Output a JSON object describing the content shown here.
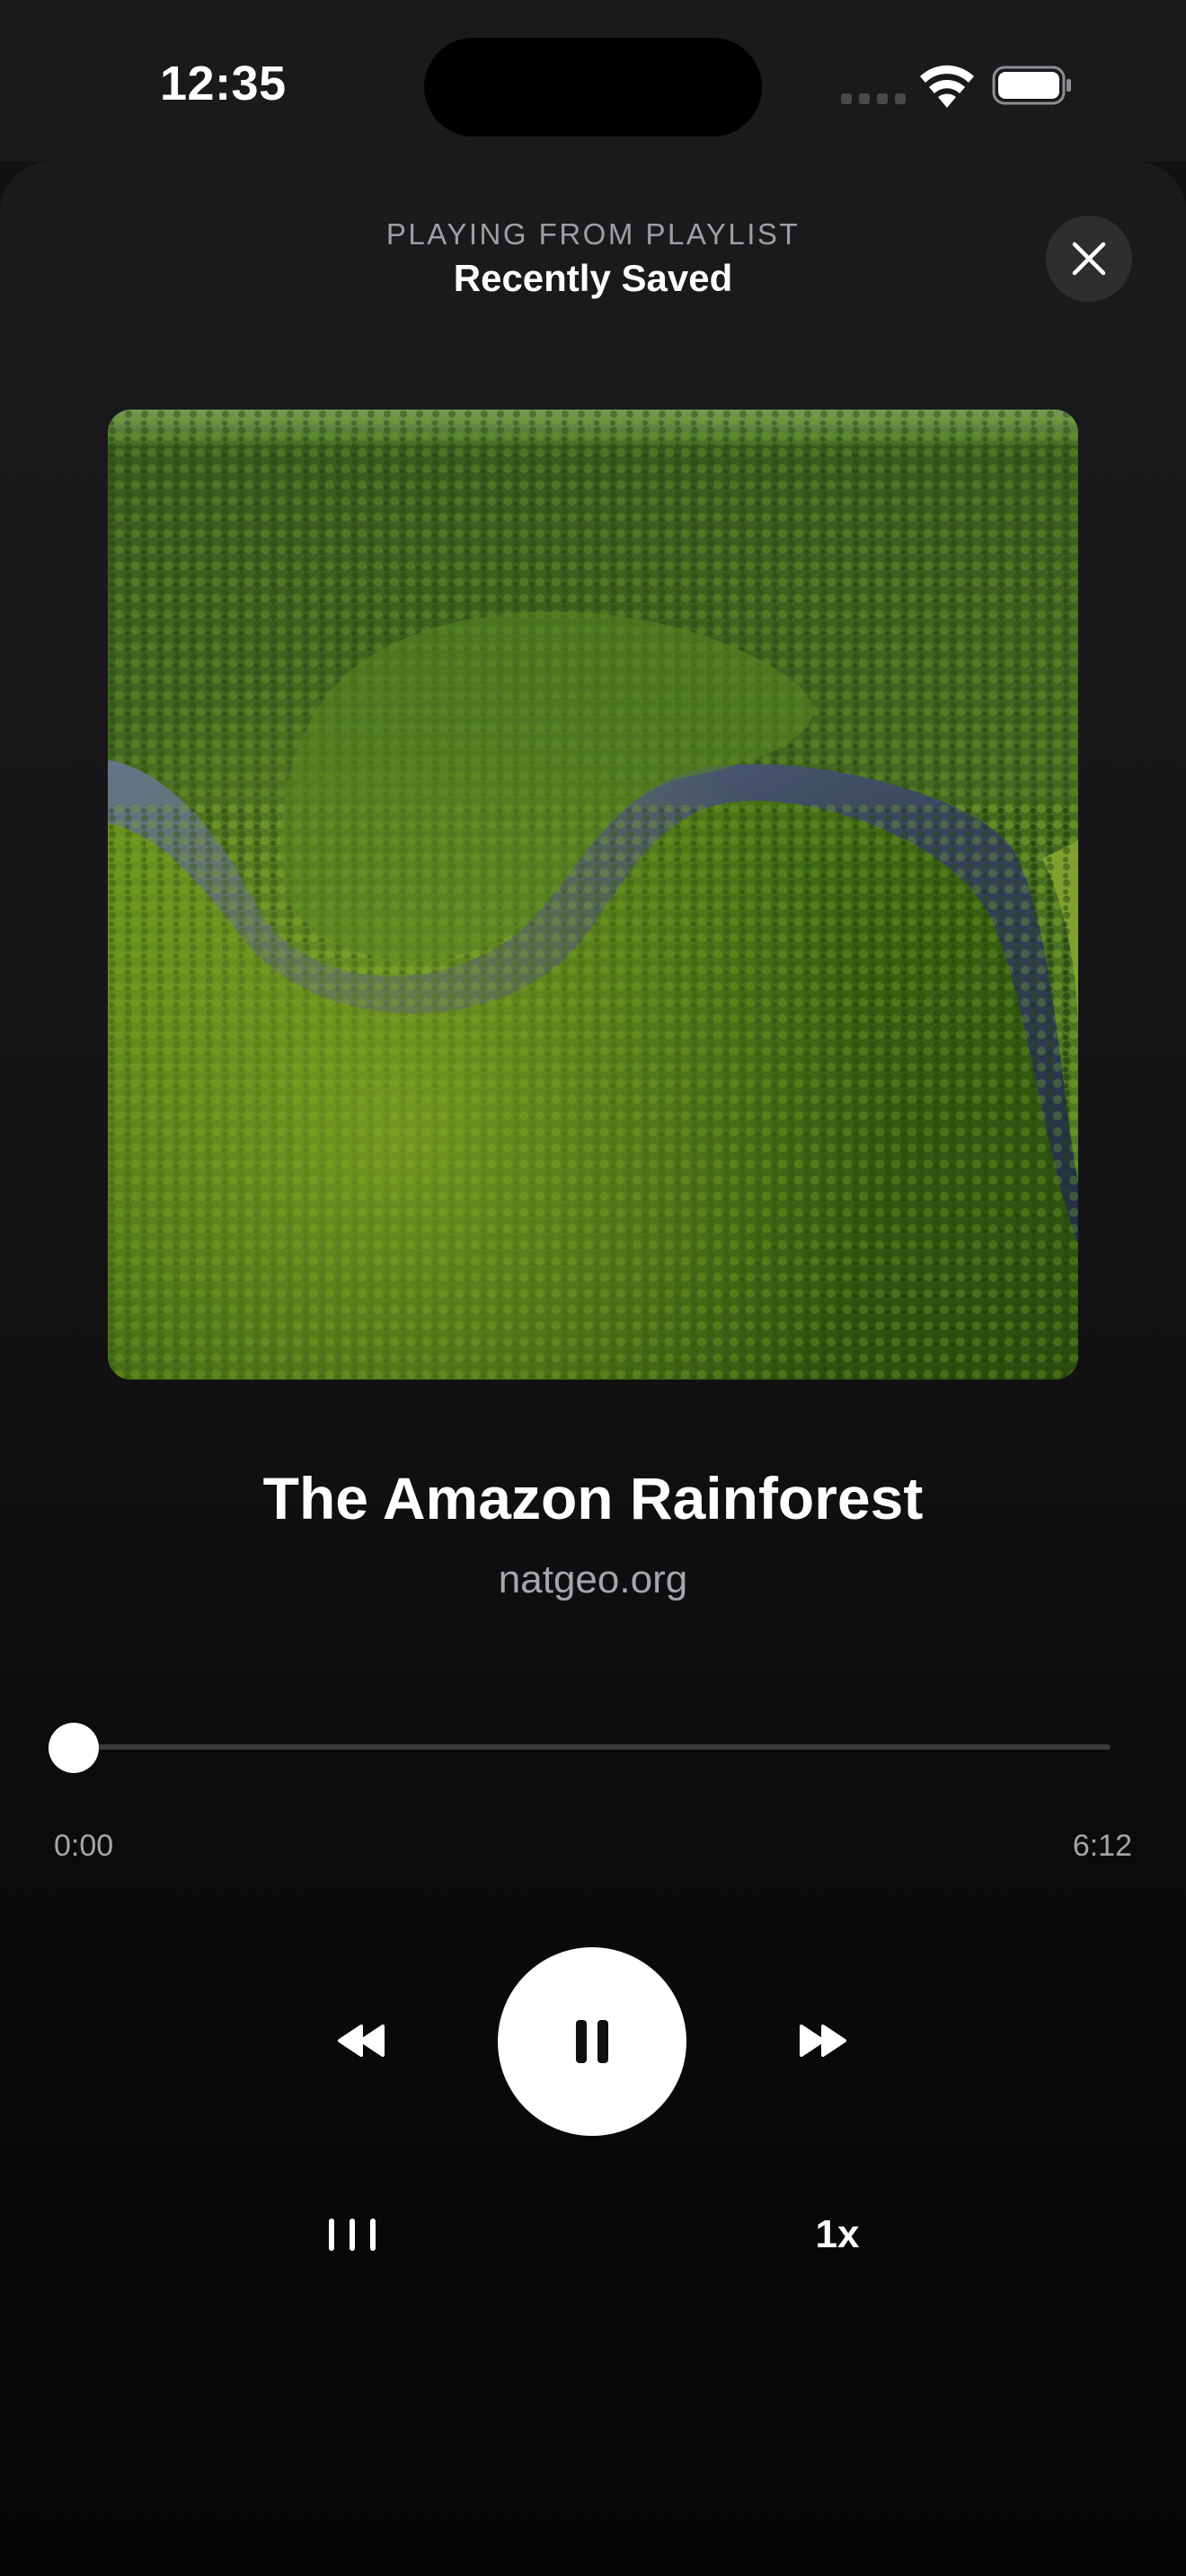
{
  "status_bar": {
    "time": "12:35"
  },
  "header": {
    "caption": "PLAYING FROM PLAYLIST",
    "playlist_name": "Recently Saved"
  },
  "track": {
    "title": "The Amazon Rainforest",
    "source": "natgeo.org",
    "artwork": "aerial view of a winding river through dense green forest"
  },
  "playback": {
    "elapsed": "0:00",
    "duration": "6:12",
    "progress_fraction": 0,
    "speed_label": "1x",
    "state": "playing"
  },
  "icons": {
    "close": "close-icon",
    "rewind": "rewind-icon",
    "pause": "pause-icon",
    "forward": "fast-forward-icon",
    "queue": "queue-icon",
    "wifi": "wifi-icon",
    "battery": "battery-icon"
  },
  "colors": {
    "background": "#111113",
    "accent": "#ffffff",
    "secondary_text": "#a5a5aa",
    "track": "#3a3a3d"
  }
}
